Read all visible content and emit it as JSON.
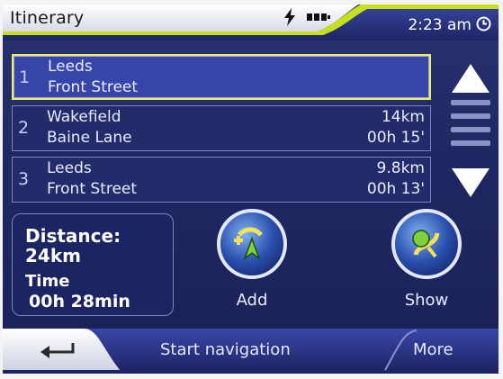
{
  "header": {
    "title": "Itinerary",
    "time": "2:23 am",
    "icons": [
      "charging-bolt-icon",
      "battery-icon",
      "clock-icon"
    ]
  },
  "itinerary": [
    {
      "index": "1",
      "city": "Leeds",
      "street": "Front Street",
      "distance": "",
      "duration": "",
      "selected": true
    },
    {
      "index": "2",
      "city": "Wakefield",
      "street": "Baine Lane",
      "distance": "14km",
      "duration": "00h 15'",
      "selected": false
    },
    {
      "index": "3",
      "city": "Leeds",
      "street": "Front Street",
      "distance": "9.8km",
      "duration": "00h 13'",
      "selected": false
    }
  ],
  "summary": {
    "distance_label": "Distance:",
    "distance_value": "24km",
    "time_label": "Time",
    "time_value": "00h 28min"
  },
  "actions": {
    "add_label": "Add",
    "show_label": "Show"
  },
  "bottom_bar": {
    "back_icon": "back-arrow-icon",
    "start_navigation": "Start navigation",
    "more": "More"
  },
  "colors": {
    "background": "#1f2762",
    "selected_row": "#3744a8",
    "selected_border": "#e8f05a",
    "header_accent": "#c6e01a"
  }
}
